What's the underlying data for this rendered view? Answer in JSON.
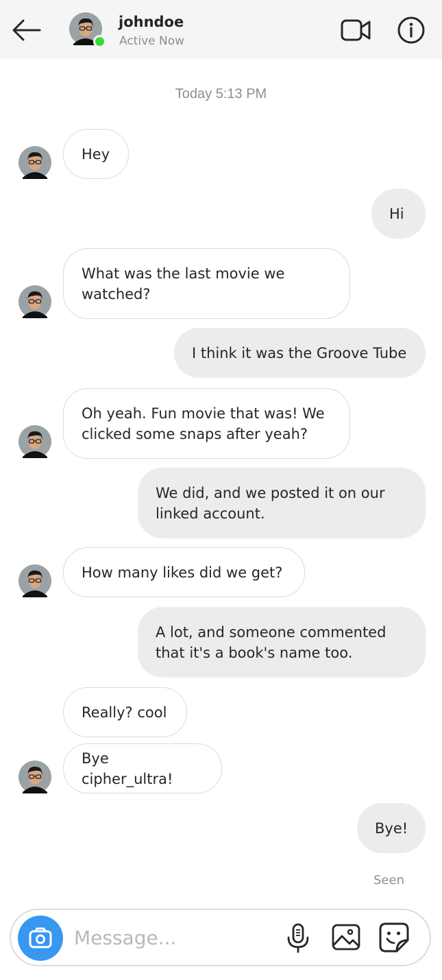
{
  "header": {
    "username": "johndoe",
    "status": "Active Now"
  },
  "chat": {
    "timestamp": "Today 5:13 PM",
    "messages": [
      {
        "sender": "them",
        "text": "Hey"
      },
      {
        "sender": "me",
        "text": "Hi"
      },
      {
        "sender": "them",
        "text": "What was the last movie we watched?"
      },
      {
        "sender": "me",
        "text": "I think it was the Groove Tube"
      },
      {
        "sender": "them",
        "text": "Oh yeah. Fun movie that was! We clicked some snaps after yeah?"
      },
      {
        "sender": "me",
        "text": "We did, and we posted it on our linked account."
      },
      {
        "sender": "them",
        "text": "How many likes did we get?"
      },
      {
        "sender": "me",
        "text": "A lot, and someone commented that it's a book's name too."
      },
      {
        "sender": "them",
        "text": "Really? cool"
      },
      {
        "sender": "them",
        "text": "Bye cipher_ultra!"
      },
      {
        "sender": "me",
        "text": "Bye!"
      }
    ],
    "seen_label": "Seen"
  },
  "composer": {
    "placeholder": "Message..."
  },
  "colors": {
    "accent": "#3897f0",
    "online": "#3bd83b",
    "outgoing_bubble": "#ececec",
    "header_bg": "#f5f5f5"
  },
  "icons": [
    "back-arrow-icon",
    "video-camera-icon",
    "info-icon",
    "camera-icon",
    "microphone-icon",
    "gallery-icon",
    "sticker-icon"
  ]
}
